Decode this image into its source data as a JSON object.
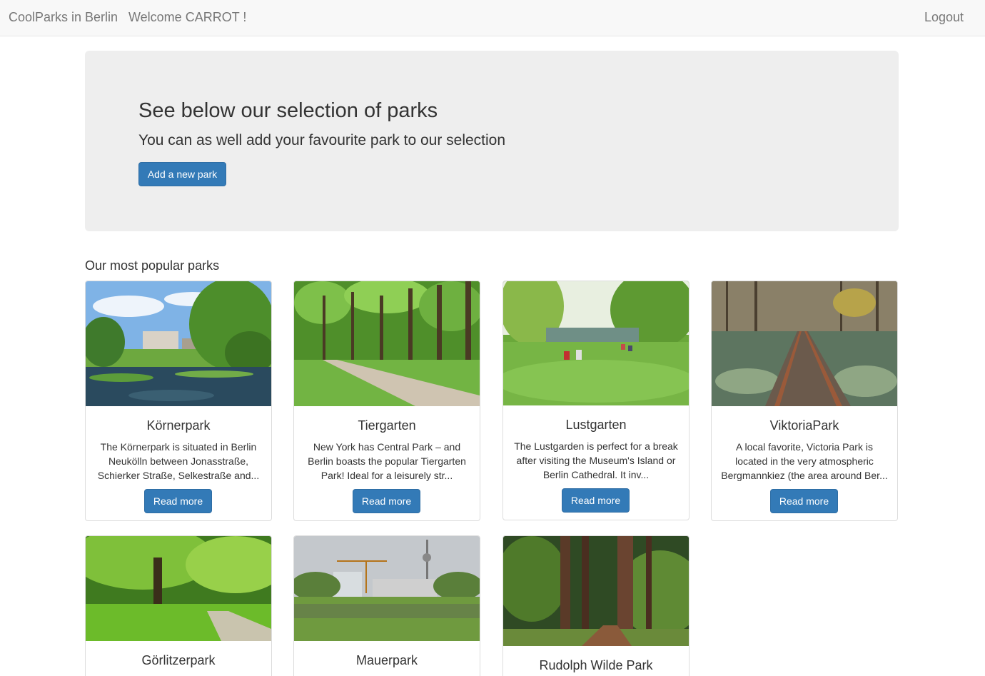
{
  "nav": {
    "brand": "CoolParks in Berlin",
    "welcome": "Welcome CARROT !",
    "logout": "Logout"
  },
  "jumbotron": {
    "title": "See below our selection of parks",
    "subtitle": "You can as well add your favourite park to our selection",
    "add_button": "Add a new park"
  },
  "section_title": "Our most popular parks",
  "parks": [
    {
      "name": "Körnerpark",
      "description": "The Körnerpark is situated in Berlin Neukölln between Jonasstraße, Schierker Straße, Selkestraße and...",
      "button": "Read more"
    },
    {
      "name": "Tiergarten",
      "description": "New York has Central Park – and Berlin boasts the popular Tiergarten Park! Ideal for a leisurely str...",
      "button": "Read more"
    },
    {
      "name": "Lustgarten",
      "description": "The Lustgarden is perfect for a break after visiting the Museum's Island or Berlin Cathedral. It inv...",
      "button": "Read more"
    },
    {
      "name": "ViktoriaPark",
      "description": "A local favorite, Victoria Park is located in the very atmospheric Bergmannkiez (the area around Ber...",
      "button": "Read more"
    },
    {
      "name": "Görlitzerpark"
    },
    {
      "name": "Mauerpark"
    },
    {
      "name": "Rudolph Wilde Park"
    }
  ],
  "colors": {
    "primary": "#337ab7",
    "navbar_bg": "#f8f8f8",
    "jumbotron_bg": "#eeeeee"
  }
}
